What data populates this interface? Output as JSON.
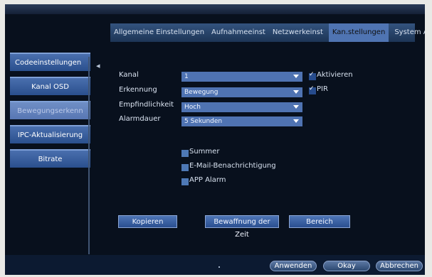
{
  "tabs": [
    {
      "label": "Allgemeine Einstellungen"
    },
    {
      "label": "Aufnahmeeinst"
    },
    {
      "label": "Netzwerkeinst"
    },
    {
      "label": "Kan.stellungen"
    },
    {
      "label": "System Admin"
    }
  ],
  "sidebar": [
    {
      "label": "Codeeinstellungen"
    },
    {
      "label": "Kanal OSD"
    },
    {
      "label": "Bewegungserkenn"
    },
    {
      "label": "IPC-Aktualisierung"
    },
    {
      "label": "Bitrate"
    }
  ],
  "settings": {
    "channel_label": "Kanal",
    "channel_value": "1",
    "detection_label": "Erkennung",
    "detection_value": "Bewegung",
    "sensitivity_label": "Empfindlichkeit",
    "sensitivity_value": "Hoch",
    "duration_label": "Alarmdauer",
    "duration_value": "5 Sekunden"
  },
  "checkboxes": {
    "activate": "Aktivieren",
    "pir": "PIR",
    "buzzer": "Summer",
    "email": "E-Mail-Benachrichtigung",
    "app_alarm": "APP Alarm"
  },
  "buttons": {
    "copy": "Kopieren",
    "arming_time": "Bewaffnung der Zeit",
    "area": "Bereich",
    "apply": "Anwenden",
    "ok": "Okay",
    "cancel": "Abbrechen"
  }
}
